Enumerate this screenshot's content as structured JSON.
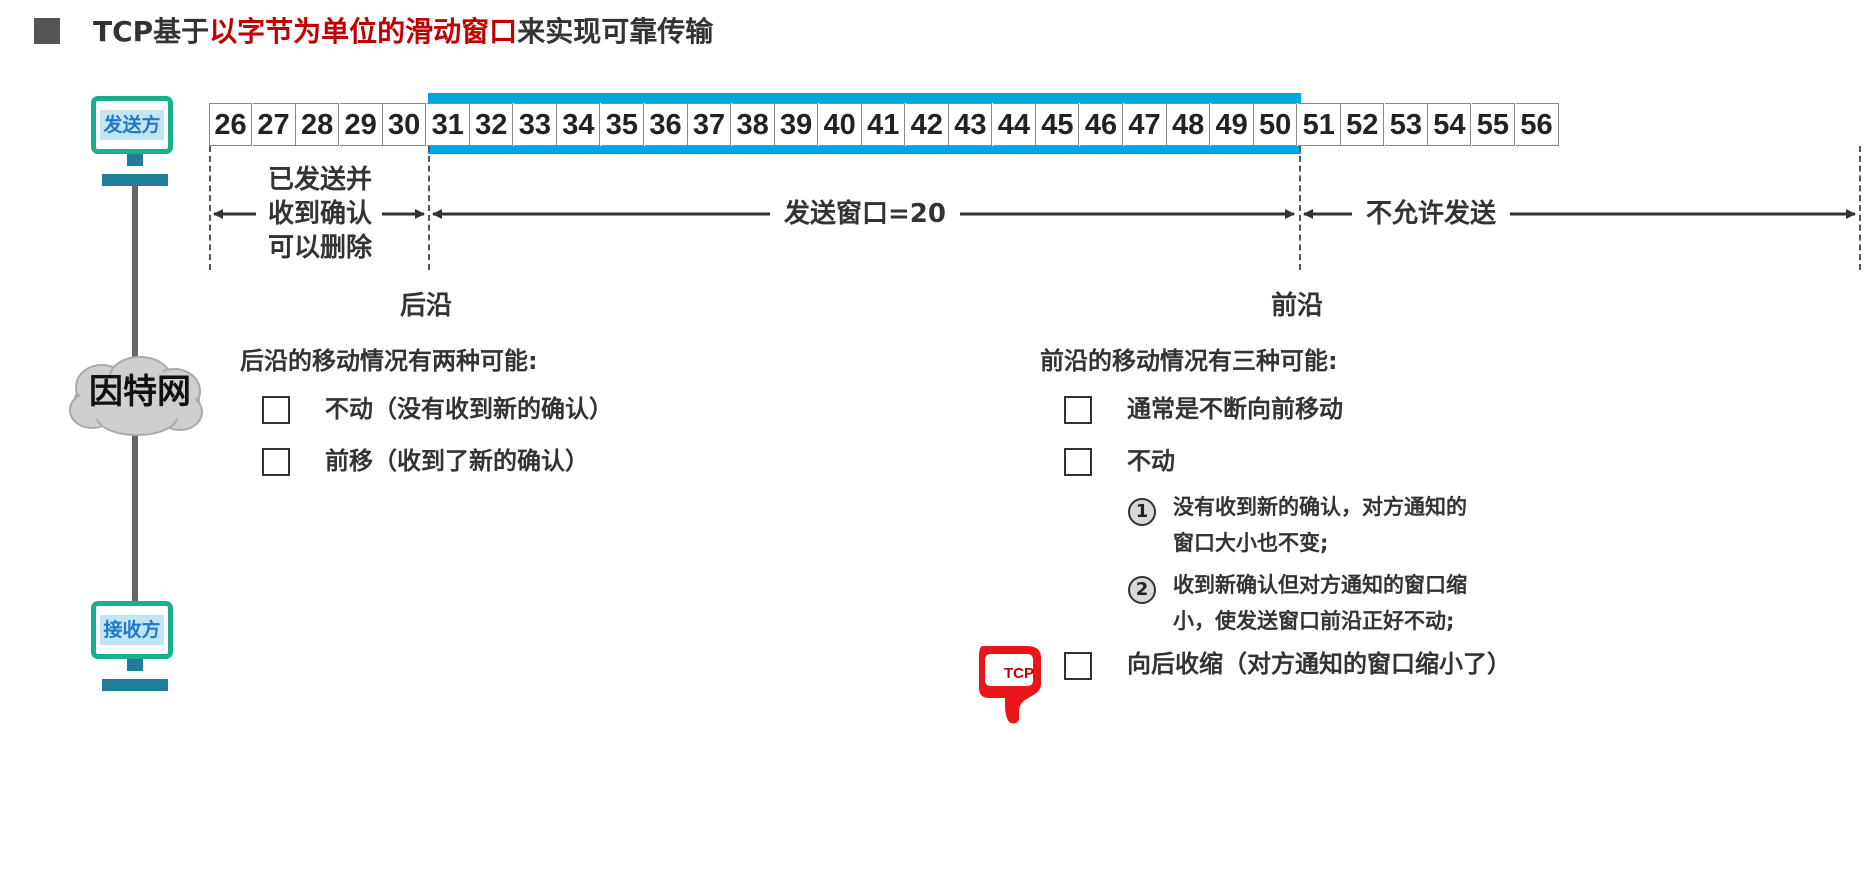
{
  "title": {
    "prefix": "TCP基于",
    "highlight": "以字节为单位的滑动窗口",
    "suffix": "来实现可靠传输"
  },
  "sender_label": "发送方",
  "receiver_label": "接收方",
  "network_label": "因特网",
  "byte_numbers": [
    26,
    27,
    28,
    29,
    30,
    31,
    32,
    33,
    34,
    35,
    36,
    37,
    38,
    39,
    40,
    41,
    42,
    43,
    44,
    45,
    46,
    47,
    48,
    49,
    50,
    51,
    52,
    53,
    54,
    55,
    56
  ],
  "segments": {
    "sent_acked_line1": "已发送并",
    "sent_acked_line2": "收到确认",
    "sent_acked_line3": "可以删除",
    "window": "发送窗口=20",
    "not_allowed": "不允许发送"
  },
  "edges": {
    "trailing": "后沿",
    "leading": "前沿"
  },
  "trailing_section": {
    "title": "后沿的移动情况有两种可能:",
    "items": [
      "不动（没有收到新的确认）",
      "前移（收到了新的确认）"
    ]
  },
  "leading_section": {
    "title": "前沿的移动情况有三种可能:",
    "items": [
      "通常是不断向前移动",
      "不动",
      "向后收缩（对方通知的窗口缩小了）"
    ],
    "sub_items": [
      {
        "num": "1",
        "line1": "没有收到新的确认，对方通知的",
        "line2": "窗口大小也不变;"
      },
      {
        "num": "2",
        "line1": "收到新确认但对方通知的窗口缩",
        "line2": "小，使发送窗口前沿正好不动;"
      }
    ]
  },
  "thumb_label": "TCP",
  "colors": {
    "accent_red": "#c00000",
    "window_bar": "#00a6e4",
    "host_border": "#1aaf8b",
    "thumb_red": "#e8151b"
  }
}
